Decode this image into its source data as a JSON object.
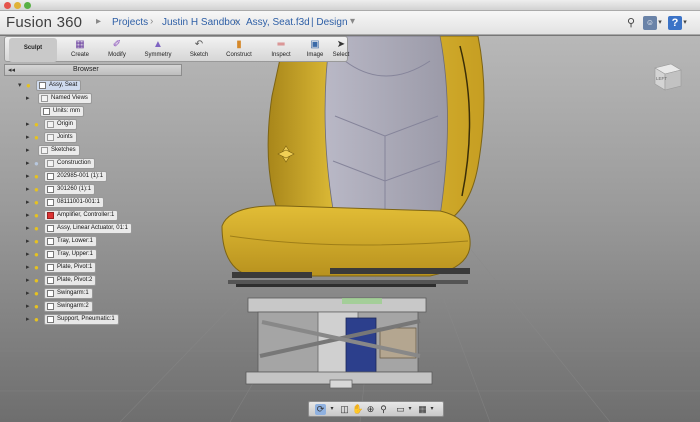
{
  "window": {
    "title": "Fusion 360"
  },
  "app": {
    "name": "Fusion 360"
  },
  "breadcrumb": {
    "items": [
      "Projects",
      "Justin H Sandbox",
      "Assy, Seat.f3d",
      "| Design"
    ]
  },
  "header_icons": {
    "search": "search-icon",
    "user": "user-avatar",
    "help": "?"
  },
  "toolbar": {
    "workspace": "Sculpt",
    "tools": [
      "Create",
      "Modify",
      "Symmetry",
      "Sketch",
      "Construct",
      "Inspect",
      "Image",
      "Select"
    ]
  },
  "browser": {
    "title": "Browser",
    "items": [
      {
        "label": "Assy, Seat",
        "indent": 0,
        "root": true
      },
      {
        "label": "Named Views",
        "indent": 1
      },
      {
        "label": "Units: mm",
        "indent": 2
      },
      {
        "label": "Origin",
        "indent": 1
      },
      {
        "label": "Joints",
        "indent": 1
      },
      {
        "label": "Sketches",
        "indent": 1
      },
      {
        "label": "Construction",
        "indent": 1
      },
      {
        "label": "202985-001 (1):1",
        "indent": 1
      },
      {
        "label": "301260 (1):1",
        "indent": 1
      },
      {
        "label": "08111001-001:1",
        "indent": 1
      },
      {
        "label": "Amplifier, Controller:1",
        "indent": 1
      },
      {
        "label": "Assy, Linear Actuator, 01:1",
        "indent": 1
      },
      {
        "label": "Tray, Lower:1",
        "indent": 1
      },
      {
        "label": "Tray, Upper:1",
        "indent": 1
      },
      {
        "label": "Plate, Pivot:1",
        "indent": 1
      },
      {
        "label": "Plate, Pivot:2",
        "indent": 1
      },
      {
        "label": "Swingarm:1",
        "indent": 1
      },
      {
        "label": "Swingarm:2",
        "indent": 1
      },
      {
        "label": "Support, Pneumatic:1",
        "indent": 1
      }
    ]
  },
  "viewcube": {
    "face": "LEFT"
  },
  "colors": {
    "seat_yellow": "#d9b52a",
    "seat_gray": "#a8a8b4",
    "accent_blue": "#3b73c7"
  }
}
